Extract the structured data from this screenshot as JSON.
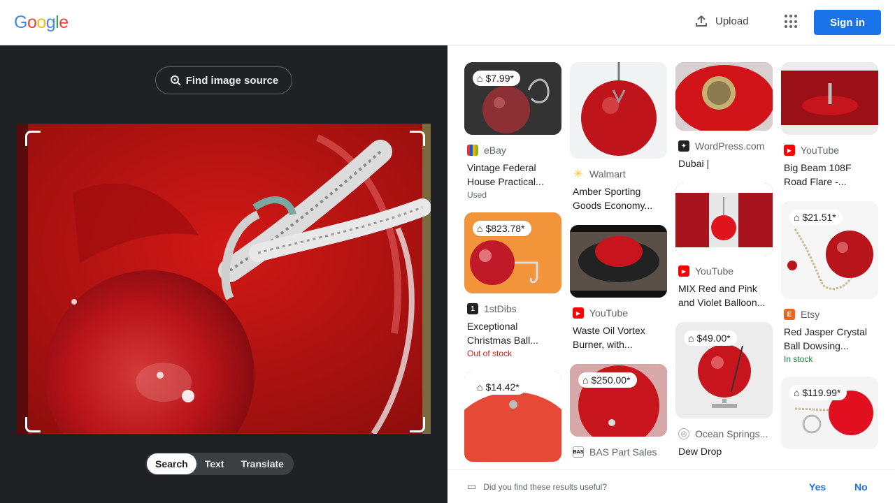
{
  "header": {
    "logo": "Google",
    "upload_label": "Upload",
    "apps_icon": "apps-grid-icon",
    "signin_label": "Sign in"
  },
  "left_panel": {
    "find_source_label": "Find image source",
    "modes": [
      {
        "label": "Search",
        "active": true
      },
      {
        "label": "Text",
        "active": false
      },
      {
        "label": "Translate",
        "active": false
      }
    ]
  },
  "results": {
    "columns": [
      [
        {
          "price": "$7.99*",
          "source": "eBay",
          "title": "Vintage Federal House Practical...",
          "status": "Used",
          "status_color": "#5f6368",
          "favicon": "ebay-icon"
        },
        {
          "price": "$823.78*",
          "source": "1stDibs",
          "title": "Exceptional Christmas Ball...",
          "status": "Out of stock",
          "status_color": "#c5221f",
          "favicon": "1stdibs-icon"
        },
        {
          "price": "$14.42*",
          "source": "",
          "title": "",
          "status": "",
          "status_color": "#5f6368",
          "favicon": ""
        }
      ],
      [
        {
          "price": "",
          "source": "Walmart",
          "title": "Amber Sporting Goods Economy...",
          "status": "",
          "status_color": "#5f6368",
          "favicon": "walmart-icon"
        },
        {
          "price": "",
          "source": "YouTube",
          "title": "Waste Oil Vortex Burner, with...",
          "status": "",
          "status_color": "#5f6368",
          "favicon": "youtube-icon"
        },
        {
          "price": "$250.00*",
          "source": "BAS Part Sales",
          "title": "",
          "status": "",
          "status_color": "#5f6368",
          "favicon": "bas-icon"
        }
      ],
      [
        {
          "price": "",
          "source": "WordPress.com",
          "title": "Dubai |",
          "status": "",
          "status_color": "#5f6368",
          "favicon": "wordpress-icon"
        },
        {
          "price": "",
          "source": "YouTube",
          "title": "MIX Red and Pink and Violet Balloon...",
          "status": "",
          "status_color": "#5f6368",
          "favicon": "youtube-icon"
        },
        {
          "price": "$49.00*",
          "source": "Ocean Springs...",
          "title": "Dew Drop",
          "status": "",
          "status_color": "#5f6368",
          "favicon": "ocean-springs-icon"
        }
      ],
      [
        {
          "price": "",
          "source": "YouTube",
          "title": "Big Beam 108F Road Flare -...",
          "status": "",
          "status_color": "#5f6368",
          "favicon": "youtube-icon"
        },
        {
          "price": "$21.51*",
          "source": "Etsy",
          "title": "Red Jasper Crystal Ball Dowsing...",
          "status": "In stock",
          "status_color": "#188038",
          "favicon": "etsy-icon"
        },
        {
          "price": "$119.99*",
          "source": "",
          "title": "",
          "status": "",
          "status_color": "#5f6368",
          "favicon": ""
        }
      ]
    ]
  },
  "feedback": {
    "question": "Did you find these results useful?",
    "yes_label": "Yes",
    "no_label": "No"
  }
}
